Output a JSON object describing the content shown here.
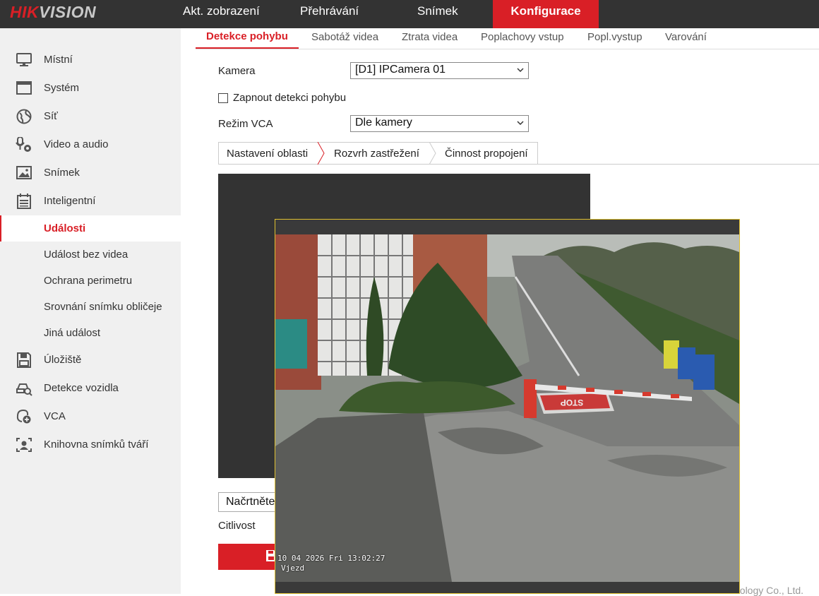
{
  "brand": {
    "logo_hik": "HIK",
    "logo_vision": "VISION"
  },
  "top_nav": [
    {
      "label": "Akt. zobrazení"
    },
    {
      "label": "Přehrávání"
    },
    {
      "label": "Snímek"
    },
    {
      "label": "Konfigurace",
      "active": true
    }
  ],
  "sidebar": {
    "items": [
      {
        "label": "Místní",
        "icon": "monitor-icon"
      },
      {
        "label": "Systém",
        "icon": "window-icon"
      },
      {
        "label": "Síť",
        "icon": "globe-icon"
      },
      {
        "label": "Video a audio",
        "icon": "mic-camera-icon"
      },
      {
        "label": "Snímek",
        "icon": "image-icon"
      },
      {
        "label": "Inteligentní",
        "icon": "calendar-icon"
      }
    ],
    "sub_items": [
      {
        "label": "Události",
        "active": true
      },
      {
        "label": "Událost bez videa"
      },
      {
        "label": "Ochrana perimetru"
      },
      {
        "label": "Srovnání snímku obličeje"
      },
      {
        "label": "Jiná událost"
      }
    ],
    "items_after": [
      {
        "label": "Úložiště",
        "icon": "floppy-icon"
      },
      {
        "label": "Detekce vozidla",
        "icon": "car-search-icon"
      },
      {
        "label": "VCA",
        "icon": "vca-gear-icon"
      },
      {
        "label": "Knihovna snímků tváří",
        "icon": "face-frame-icon"
      }
    ]
  },
  "sub_tabs": [
    {
      "label": "Detekce pohybu",
      "active": true
    },
    {
      "label": "Sabotáž videa"
    },
    {
      "label": "Ztrata videa"
    },
    {
      "label": "Poplachovy vstup"
    },
    {
      "label": "Popl.vystup"
    },
    {
      "label": "Varování"
    }
  ],
  "form": {
    "camera_label": "Kamera",
    "camera_value": "[D1] IPCamera 01",
    "enable_label": "Zapnout detekci pohybu",
    "enable_checked": false,
    "vca_label": "Režim VCA",
    "vca_value": "Dle kamery"
  },
  "inner_tabs": [
    {
      "label": "Nastavení oblasti",
      "active": true
    },
    {
      "label": "Rozvrh zastřežení"
    },
    {
      "label": "Činnost propojení"
    }
  ],
  "draw_select_value": "Načrtněte",
  "sensitivity_label": "Citlivost",
  "footer_text": "nology Co., Ltd.",
  "preview": {
    "osd_datetime": "10 04 2026 Fri 13:02:27",
    "osd_name": "Vjezd",
    "road_marking": "STOP"
  },
  "colors": {
    "brand_red": "#d91f26",
    "topbar": "#333333",
    "sidebar_bg": "#f0f0f0",
    "popup_border": "#e0c030"
  }
}
